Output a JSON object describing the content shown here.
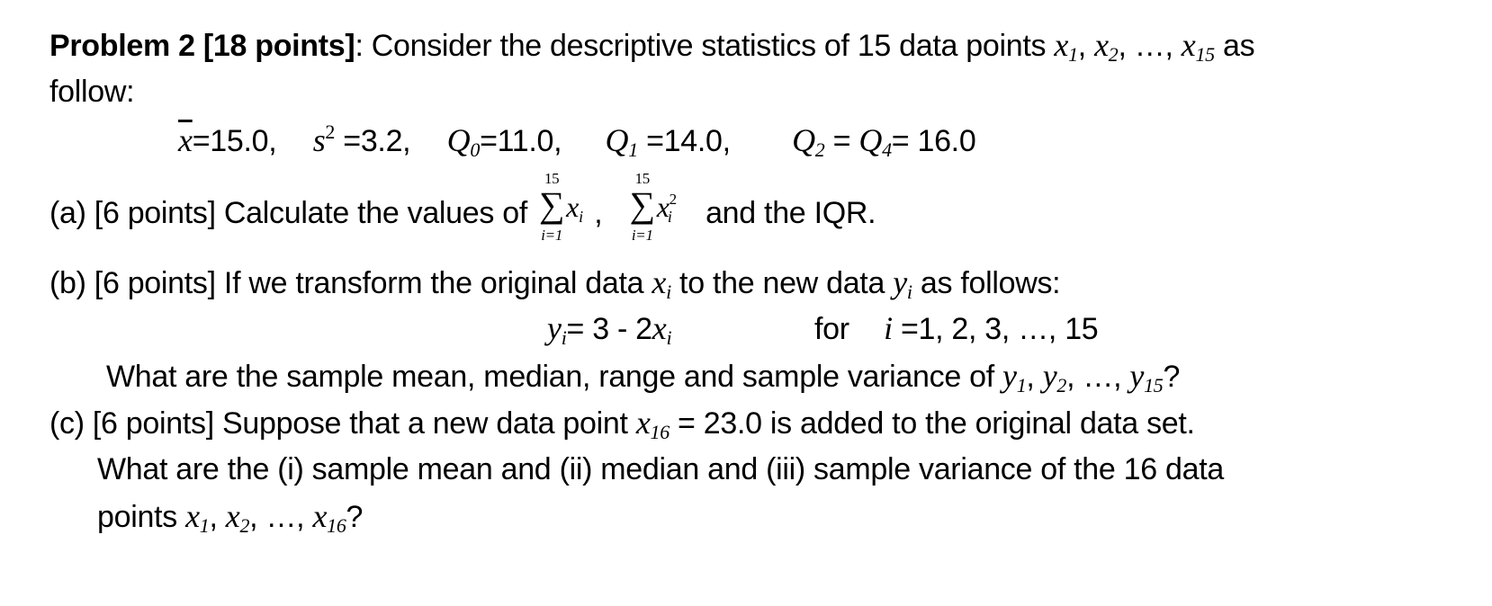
{
  "problem": {
    "title": "Problem 2 [18 points]",
    "intro_text": ": Consider the descriptive statistics of 15 data points ",
    "intro_vars": [
      "x",
      "1",
      "x",
      "2",
      "x",
      "15"
    ],
    "intro_sep_1": ", ",
    "intro_sep_2": ", …, ",
    "intro_tail": " as",
    "intro_line2": "follow:"
  },
  "statistics": {
    "mean_symbol": "x",
    "mean_value": "=15.0,",
    "variance_symbol": "s",
    "variance_exp": "2",
    "variance_value": "=3.2,",
    "q0_symbol": "Q",
    "q0_sub": "0",
    "q0_value": "=11.0,",
    "q1_symbol": "Q",
    "q1_sub": "1",
    "q1_value": "=14.0,",
    "q2_symbol": "Q",
    "q2_sub": "2",
    "q2_equals": " = ",
    "q4_symbol": "Q",
    "q4_sub": "4",
    "q4_value": "= 16.0"
  },
  "part_a": {
    "label": "(a) [6 points] Calculate the values of ",
    "sum1": {
      "upper": "15",
      "lower": "i=1",
      "var": "x",
      "sub": "i"
    },
    "separator": " ,",
    "sum2": {
      "upper": "15",
      "lower": "i=1",
      "var": "x",
      "sub": "i",
      "sup": "2"
    },
    "tail": "and the IQR."
  },
  "part_b": {
    "label": "(b) [6 points] If we transform the original data ",
    "var_x": "x",
    "var_x_sub": "i",
    "mid": " to the new data ",
    "var_y": "y",
    "var_y_sub": "i",
    "tail": " as follows:",
    "formula_lhs": "y",
    "formula_lhs_sub": "i",
    "formula_rhs": "= 3 - 2",
    "formula_x": "x",
    "formula_x_sub": "i",
    "for_label": "for",
    "index_var": "i",
    "index_range": " =1, 2, 3, …, 15",
    "question": "What are the sample mean, median, range and sample variance of ",
    "question_vars": [
      "y",
      "1",
      "y",
      "2",
      "y",
      "15"
    ],
    "question_sep_1": ", ",
    "question_sep_2": ", …, ",
    "question_tail": "?"
  },
  "part_c": {
    "label": "(c) [6 points] Suppose that a new data point ",
    "new_var": "x",
    "new_var_sub": "16",
    "new_value": " = 23.0 is added to the original data set.",
    "question_line1": "What are the (i) sample mean and (ii) median and (iii) sample variance of the 16 data",
    "question_line2_prefix": "points ",
    "question_vars": [
      "x",
      "1",
      "x",
      "2",
      "x",
      "16"
    ],
    "question_sep_1": ", ",
    "question_sep_2": ", …, ",
    "question_tail": "?"
  }
}
